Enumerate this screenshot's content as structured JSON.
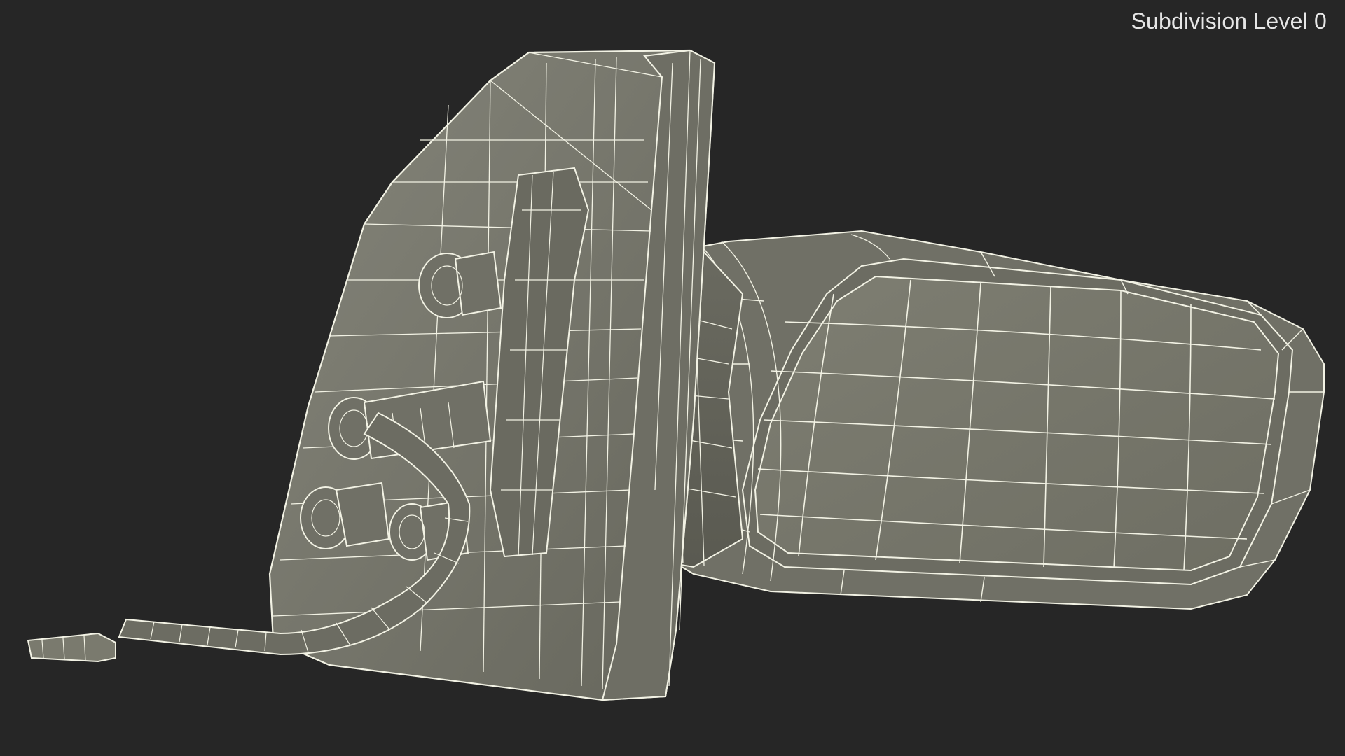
{
  "viewport": {
    "background_color": "#262626",
    "label": "Subdivision Level 0",
    "label_color": "#e6e6e6",
    "mesh_fill_color": "#76766a",
    "mesh_shadow_color": "#5c5c52",
    "wire_color": "#f2f2e4",
    "model_icon": "car-side-mirror-wireframe"
  }
}
